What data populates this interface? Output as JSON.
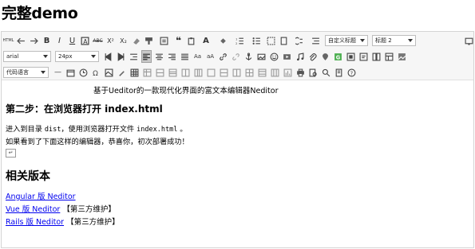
{
  "page": {
    "title": "完整demo"
  },
  "toolbar": {
    "row1_buttons": [
      "html",
      "undo",
      "redo",
      "bold",
      "italic",
      "underline",
      "fontborder",
      "strikethrough",
      "superscript",
      "subscript",
      "removeformat",
      "formatmatch",
      "autotypeset",
      "blockquote",
      "pasteplain",
      "forecolor",
      "backcolor",
      "insertorderedlist",
      "insertunorderedlist",
      "selectall",
      "cleardoc"
    ],
    "custom_style": "自定义标题",
    "paragraph": "标题 2",
    "font_family": "arial",
    "font_size": "24px",
    "code_language": "代码语言"
  },
  "content": {
    "intro": "基于Ueditor的一款现代化界面的富文本编辑器Neditor",
    "step_heading": "第二步：在浏览器打开 index.html",
    "step_line_a_before": "进入到目录 ",
    "step_line_a_code1": "dist",
    "step_line_a_mid": "，使用浏览器打开文件 ",
    "step_line_a_code2": "index.html",
    "step_line_a_after": " 。",
    "step_line_b": "如果看到了下面这样的编辑器，恭喜你，初次部署成功！",
    "img_placeholder": "↵",
    "versions_heading": "相关版本",
    "links": [
      {
        "text": "Angular 版 Neditor",
        "note": ""
      },
      {
        "text": "Vue 版 Neditor",
        "note": "【第三方维护】"
      },
      {
        "text": "Rails 版 Neditor",
        "note": "【第三方维护】"
      }
    ]
  }
}
